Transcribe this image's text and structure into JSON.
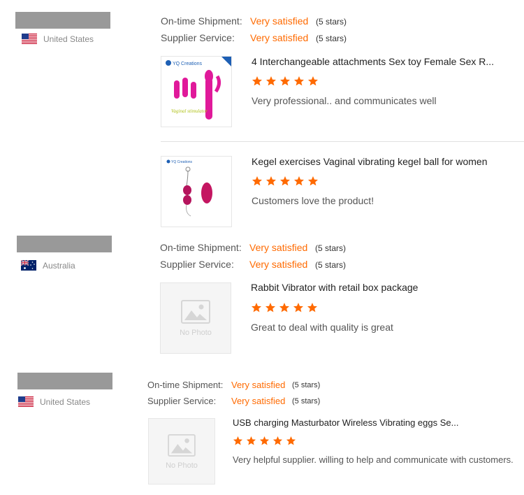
{
  "labels": {
    "shipment": "On-time Shipment:",
    "service": "Supplier Service:"
  },
  "reviews": [
    {
      "country": "United States",
      "flag": "us-flag-icon",
      "shipment_value": "Very satisfied",
      "shipment_stars": "(5 stars)",
      "service_value": "Very satisfied",
      "service_stars": "(5 stars)",
      "products": [
        {
          "title": "4 Interchangeable attachments Sex toy Female Sex R...",
          "rating": 5,
          "comment": "Very professional.. and communicates well",
          "thumb_brand": "YQ Creations",
          "thumb_caption": "Vaginal stimulator"
        },
        {
          "title": "Kegel exercises Vaginal vibrating kegel ball for women",
          "rating": 5,
          "comment": "Customers love the product!",
          "thumb_brand": "YQ Creations"
        }
      ]
    },
    {
      "country": "Australia",
      "flag": "au-flag-icon",
      "shipment_value": "Very satisfied",
      "shipment_stars": "(5 stars)",
      "service_value": "Very satisfied",
      "service_stars": "(5 stars)",
      "products": [
        {
          "title": "Rabbit Vibrator with retail box package",
          "rating": 5,
          "comment": "Great to deal with quality is great",
          "thumb_text": "No Photo"
        }
      ]
    },
    {
      "country": "United States",
      "flag": "us-flag-icon",
      "shipment_value": "Very satisfied",
      "shipment_stars": "(5 stars)",
      "service_value": "Very satisfied",
      "service_stars": "(5 stars)",
      "products": [
        {
          "title": "USB charging Masturbator Wireless Vibrating eggs Se...",
          "rating": 5,
          "comment": "Very helpful supplier. willing to help and communicate with customers.",
          "thumb_text": "No Photo"
        }
      ]
    }
  ],
  "colors": {
    "accent": "#ff6a00",
    "star": "#ff6a00",
    "redacted": "#999999"
  }
}
